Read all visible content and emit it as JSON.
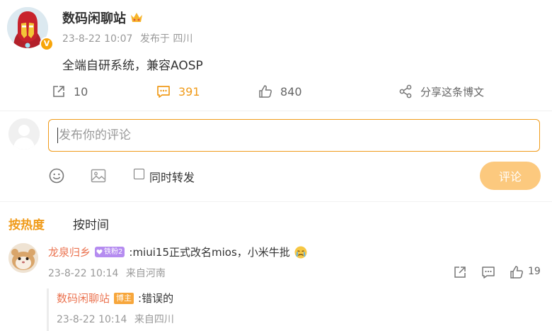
{
  "post": {
    "author": "数码闲聊站",
    "verified_badge": "V",
    "time": "23-8-22 10:07",
    "location": "发布于 四川",
    "text": "全端自研系统，兼容AOSP",
    "actions": {
      "repost_count": "10",
      "comment_count": "391",
      "like_count": "840",
      "share_label": "分享这条博文"
    }
  },
  "compose": {
    "placeholder": "发布你的评论",
    "repost_label": "同时转发",
    "submit_label": "评论"
  },
  "sort": {
    "hot_label": "按热度",
    "time_label": "按时间"
  },
  "comments": [
    {
      "user": "龙泉归乡",
      "badge": "铁粉2",
      "text": ":miui15正式改名mios，小米牛批",
      "time": "23-8-22 10:14",
      "location": "来自河南",
      "likes": "19",
      "replies": [
        {
          "user": "数码闲聊站",
          "badge": "博主",
          "text": ":错误的",
          "time": "23-8-22 10:14",
          "location": "来自四川"
        }
      ]
    }
  ],
  "colors": {
    "accent": "#f09b1a",
    "username": "#eb7350",
    "muted": "#999999",
    "submit_disabled": "#fcc97e"
  }
}
